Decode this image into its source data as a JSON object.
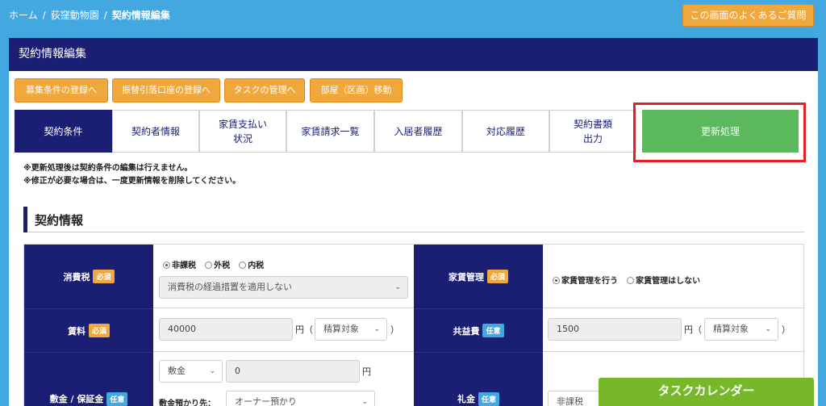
{
  "breadcrumb": {
    "home": "ホーム",
    "zoo": "荻窪動物園",
    "current": "契約情報編集"
  },
  "faq_button": "この画面のよくあるご質問",
  "panel_title": "契約情報編集",
  "action_buttons": [
    "募集条件の登録へ",
    "振替引落口座の登録へ",
    "タスクの管理へ",
    "部屋（区画）移動"
  ],
  "tabs": [
    {
      "label": "契約条件",
      "state": "active"
    },
    {
      "label": "契約者情報",
      "state": "normal"
    },
    {
      "label": "家賃支払い状況",
      "state": "normal"
    },
    {
      "label": "家賃請求一覧",
      "state": "normal"
    },
    {
      "label": "入居者履歴",
      "state": "normal"
    },
    {
      "label": "対応履歴",
      "state": "normal"
    },
    {
      "label": "契約書類出力",
      "state": "normal"
    },
    {
      "label": "更新処理",
      "state": "highlighted"
    }
  ],
  "notes": [
    "※更新処理後は契約条件の編集は行えません。",
    "※修正が必要な場合は、一度更新情報を削除してください。"
  ],
  "section_title": "契約情報",
  "badges": {
    "required": "必須",
    "optional": "任意"
  },
  "form": {
    "tax": {
      "label": "消費税",
      "options": [
        "非課税",
        "外税",
        "内税"
      ],
      "selected": "非課税",
      "select_value": "消費税の経過措置を適用しない"
    },
    "rent_mgmt": {
      "label": "家賃管理",
      "options": [
        "家賃管理を行う",
        "家賃管理はしない"
      ],
      "selected": "家賃管理を行う"
    },
    "rent": {
      "label": "賃料",
      "value": "40000",
      "unit": "円（",
      "settle": "精算対象",
      "close": "）"
    },
    "common_fee": {
      "label": "共益費",
      "value": "1500",
      "unit": "円（",
      "settle": "精算対象",
      "close": "）"
    },
    "deposit": {
      "label": "敷金 / 保証金",
      "type": "敷金",
      "value": "0",
      "unit": "円",
      "holder_label": "敷金預かり先：",
      "holder": "オーナー預かり"
    },
    "key_money": {
      "label": "礼金",
      "tax": "非課税"
    }
  },
  "task_calendar": "タスクカレンダー",
  "colors": {
    "navy": "#1b1f74",
    "orange": "#f0a73c",
    "blue_bg": "#43a7e0",
    "green": "#5cb85c",
    "red_highlight": "#e0212a"
  }
}
